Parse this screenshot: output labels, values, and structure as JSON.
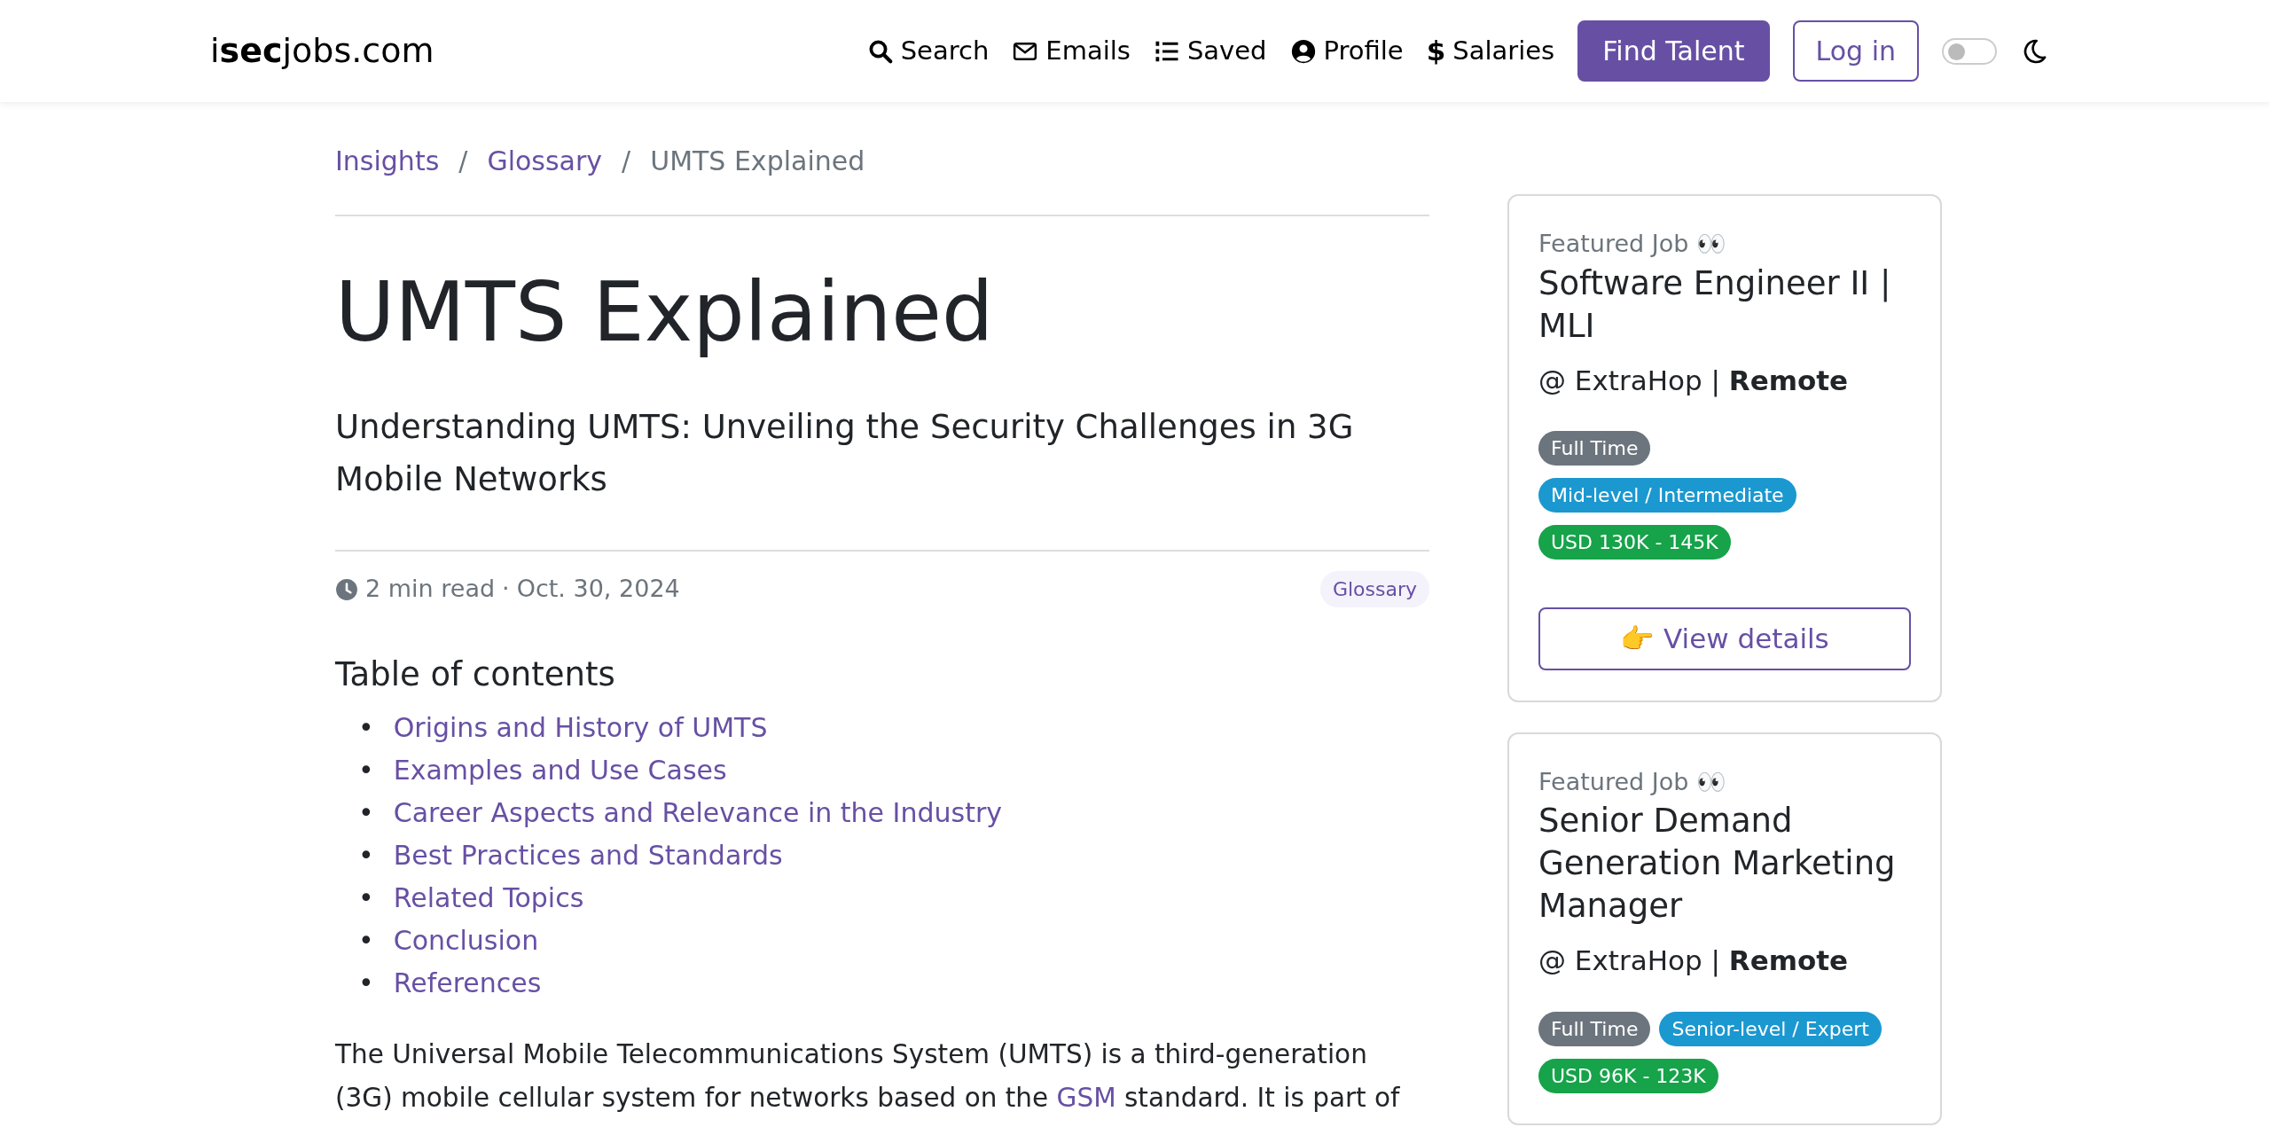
{
  "navbar": {
    "brand": "i**sec**jobs.com",
    "links": [
      "Search",
      "Emails",
      "Saved",
      "Profile",
      "Salaries"
    ],
    "salaries_symbol": "$",
    "primary_button": "Find Talent",
    "login_button": "Log in",
    "theme_switch": {
      "checked": false
    }
  },
  "breadcrumb": {
    "items": [
      {
        "label": "Insights",
        "current": false
      },
      {
        "label": "Glossary",
        "current": false
      },
      {
        "label": "UMTS Explained",
        "current": true
      }
    ],
    "separators": [
      "/",
      "/"
    ]
  },
  "article": {
    "title": "UMTS Explained",
    "subtitle": "Understanding UMTS: Unveiling the Security Challenges in 3G Mobile Networks",
    "read_time": "2 min read",
    "separator": "·",
    "date": "Oct. 30, 2024",
    "tag": "Glossary",
    "toc_heading": "Table of contents",
    "toc": [
      {
        "bullet": "•",
        "label": "Origins and History of UMTS"
      },
      {
        "bullet": "•",
        "label": "Examples and Use Cases"
      },
      {
        "bullet": "•",
        "label": "Career Aspects and Relevance in the Industry"
      },
      {
        "bullet": "•",
        "label": "Best Practices and Standards"
      },
      {
        "bullet": "•",
        "label": "Related Topics"
      },
      {
        "bullet": "•",
        "label": "Conclusion"
      },
      {
        "bullet": "•",
        "label": "References"
      }
    ],
    "paragraph": [
      {
        "text": "The Universal Mobile Telecommunications System (UMTS) is a third-generation (3G) mobile cellular system for networks based on the ",
        "link": false
      },
      {
        "text": "GSM",
        "link": true
      },
      {
        "text": " standard. It is part of",
        "link": false
      }
    ]
  },
  "featured_jobs": [
    {
      "label": "Featured Job 👀",
      "title": "Software Engineer II | MLI",
      "company": "@ ExtraHop | **Remote**",
      "badges": [
        {
          "text": "Full Time",
          "kind": "type"
        },
        {
          "text": "Mid-level / Intermediate",
          "kind": "level"
        },
        {
          "text": "USD 130K - 145K",
          "kind": "salary"
        }
      ],
      "button": "👉 View details"
    },
    {
      "label": "Featured Job 👀",
      "title": "Senior Demand Generation Marketing Manager",
      "company": "@ ExtraHop | **Remote**",
      "badges": [
        {
          "text": "Full Time",
          "kind": "type"
        },
        {
          "text": "Senior-level / Expert",
          "kind": "level"
        },
        {
          "text": "USD 96K - 123K",
          "kind": "salary"
        }
      ]
    }
  ]
}
